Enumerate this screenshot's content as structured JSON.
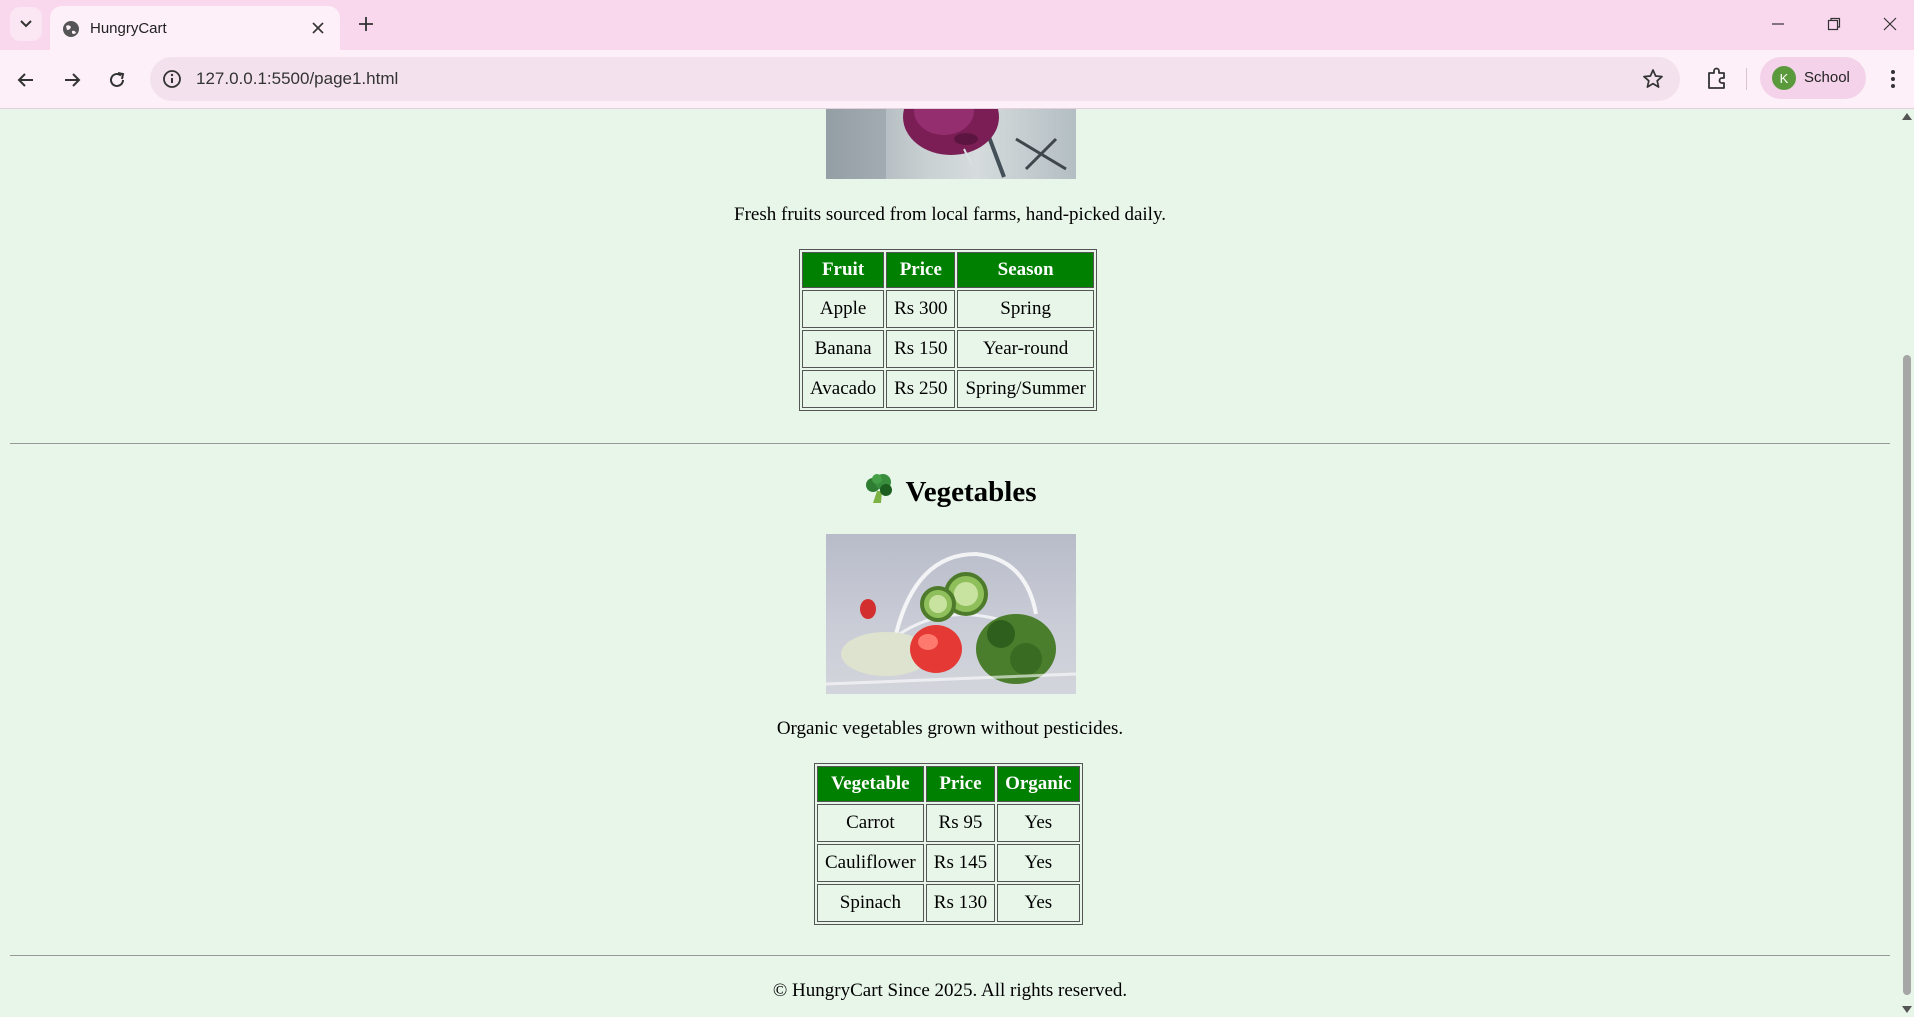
{
  "browser": {
    "tab_title": "HungryCart",
    "url": "127.0.0.1:5500/page1.html",
    "profile_initial": "K",
    "profile_name": "School"
  },
  "page": {
    "fruits_description": "Fresh fruits sourced from local farms, hand-picked daily.",
    "fruits_table": {
      "headers": [
        "Fruit",
        "Price",
        "Season"
      ],
      "rows": [
        [
          "Apple",
          "Rs 300",
          "Spring"
        ],
        [
          "Banana",
          "Rs 150",
          "Year-round"
        ],
        [
          "Avacado",
          "Rs 250",
          "Spring/Summer"
        ]
      ]
    },
    "vegetables_heading": "Vegetables",
    "vegetables_emoji": "broccoli-icon",
    "vegetables_description": "Organic vegetables grown without pesticides.",
    "vegetables_table": {
      "headers": [
        "Vegetable",
        "Price",
        "Organic"
      ],
      "rows": [
        [
          "Carrot",
          "Rs 95",
          "Yes"
        ],
        [
          "Cauliflower",
          "Rs 145",
          "Yes"
        ],
        [
          "Spinach",
          "Rs 130",
          "Yes"
        ]
      ]
    },
    "footer": "© HungryCart Since 2025. All rights reserved."
  },
  "colors": {
    "page_background": "#e8f5e9",
    "table_header": "#008000",
    "tabbar": "#f9d8ee"
  }
}
